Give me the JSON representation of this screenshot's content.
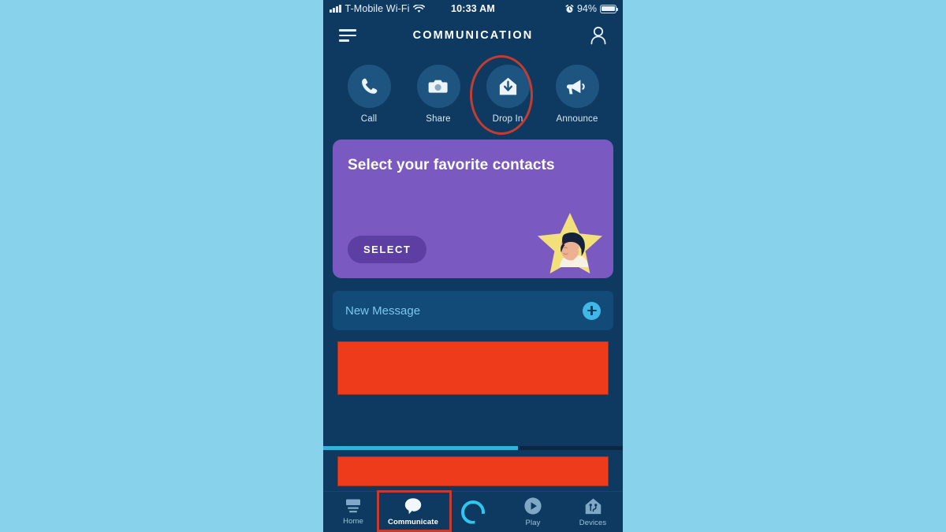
{
  "status_bar": {
    "carrier": "T-Mobile Wi-Fi",
    "signal_icon": "cellular-bars-icon",
    "wifi_icon": "wifi-icon",
    "time": "10:33 AM",
    "alarm_icon": "alarm-clock-icon",
    "battery_percent": "94%",
    "battery_icon": "battery-icon"
  },
  "app_header": {
    "menu_icon": "hamburger-menu-icon",
    "title": "COMMUNICATION",
    "profile_icon": "person-icon"
  },
  "quick_actions": {
    "items": [
      {
        "label": "Call",
        "icon": "phone-icon",
        "highlighted": false
      },
      {
        "label": "Share",
        "icon": "camera-icon",
        "highlighted": false
      },
      {
        "label": "Drop In",
        "icon": "drop-in-icon",
        "highlighted": true
      },
      {
        "label": "Announce",
        "icon": "megaphone-icon",
        "highlighted": false
      }
    ],
    "highlight_color": "#c43c30",
    "circle_color": "#1d5480"
  },
  "promo_card": {
    "title": "Select your favorite contacts",
    "button_label": "SELECT",
    "illustration": "star-with-face-icon",
    "card_color": "#7a5ac0",
    "button_color": "#5d3ea3",
    "star_color": "#f2e07a"
  },
  "new_message": {
    "label": "New Message",
    "add_icon": "plus-circle-icon",
    "accent_color": "#3fb8e8"
  },
  "redactions": {
    "block_color": "#ee3b1c",
    "block_1": "redacted-content-block",
    "block_2": "redacted-content-block"
  },
  "progress": {
    "fill_percent": 65,
    "fill_color": "#35aee0"
  },
  "tab_bar": {
    "items": [
      {
        "label": "Home",
        "icon": "home-icon",
        "active": false
      },
      {
        "label": "Communicate",
        "icon": "speech-bubble-icon",
        "active": true
      },
      {
        "label": "",
        "icon": "alexa-ring-icon",
        "active": false
      },
      {
        "label": "Play",
        "icon": "play-icon",
        "active": false
      },
      {
        "label": "Devices",
        "icon": "devices-house-icon",
        "active": false
      }
    ],
    "highlight_color": "#c43c30"
  },
  "page": {
    "outer_background": "#88d2ec",
    "phone_background": "#0e3a61"
  }
}
